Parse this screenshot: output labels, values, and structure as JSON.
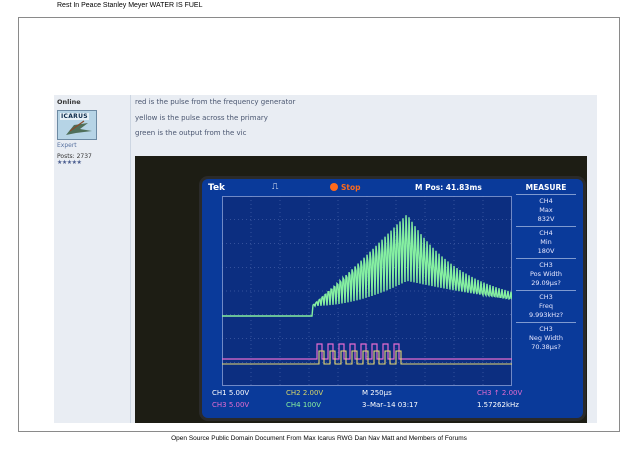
{
  "document": {
    "header": "Rest In Peace Stanley Meyer  WATER IS FUEL",
    "footer": "Open Source Public Domain Document     From Max Icarus  RWG Dan Nav Matt and Members of Forums"
  },
  "post": {
    "author": {
      "status": "Online",
      "avatar_text": "ICARUS",
      "rank": "Expert",
      "posts": "Posts: 2737",
      "stars": "★★★★★"
    },
    "lines": [
      "red is the pulse from the frequency generator",
      "yellow is the pulse across the primary",
      "green is the output from the vic"
    ]
  },
  "scope": {
    "brand": "Tek",
    "state": "Stop",
    "position": "M Pos: 41.83ms",
    "measure_title": "MEASURE",
    "measurements": [
      {
        "l1": "CH4",
        "l2": "Max",
        "l3": "832V"
      },
      {
        "l1": "CH4",
        "l2": "Min",
        "l3": "180V"
      },
      {
        "l1": "CH3",
        "l2": "Pos Width",
        "l3": "29.09μs?"
      },
      {
        "l1": "CH3",
        "l2": "Freq",
        "l3": "9.993kHz?"
      },
      {
        "l1": "CH3",
        "l2": "Neg Width",
        "l3": "70.38μs?"
      }
    ],
    "row1": {
      "ch1": "CH1  5.00V",
      "ch2": "CH2  2.00V",
      "m": "M 250μs",
      "trig": "CH3 ↑ 2.00V"
    },
    "row2": {
      "ch3": "CH3  5.00V",
      "ch4": "CH4  100V",
      "date": "3–Mar–14 03:17",
      "freq": "1.57262kHz"
    },
    "colors": {
      "ch4": "#86f0a0",
      "ch3": "#e56cd0",
      "screen": "#0c2e80"
    }
  }
}
